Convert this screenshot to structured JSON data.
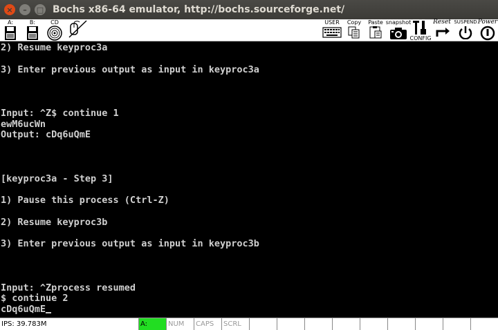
{
  "window": {
    "title": "Bochs x86-64 emulator, http://bochs.sourceforge.net/",
    "buttons": {
      "close": "×",
      "minimize": "–",
      "maximize": "□"
    }
  },
  "toolbar": {
    "left": [
      {
        "label": "A:",
        "icon": "floppy-icon"
      },
      {
        "label": "B:",
        "icon": "floppy-icon"
      },
      {
        "label": "CD",
        "icon": "cdrom-icon"
      },
      {
        "label": "",
        "icon": "mouse-icon"
      }
    ],
    "right": {
      "user": "USER",
      "copy": "Copy",
      "paste": "Paste",
      "snapshot": "snapshot",
      "config": "CONFIG",
      "reset": "Reset",
      "suspend": "SUSPEND",
      "power": "Power"
    }
  },
  "screen": {
    "lines": [
      "2) Resume keyproc3a",
      "",
      "3) Enter previous output as input in keyproc3a",
      "",
      "",
      "",
      "Input: ^Z$ continue 1",
      "ewM6ucWn",
      "Output: cDq6uQmE",
      "",
      "",
      "",
      "[keyproc3a - Step 3]",
      "",
      "1) Pause this process (Ctrl-Z)",
      "",
      "2) Resume keyproc3b",
      "",
      "3) Enter previous output as input in keyproc3b",
      "",
      "",
      "",
      "Input: ^Zprocess resumed",
      "$ continue 2",
      "cDq6uQmE"
    ]
  },
  "statusbar": {
    "ips": "IPS: 39.783M",
    "a": "A:",
    "num": "NUM",
    "caps": "CAPS",
    "scrl": "SCRL",
    "led_color": "#22dd22"
  }
}
